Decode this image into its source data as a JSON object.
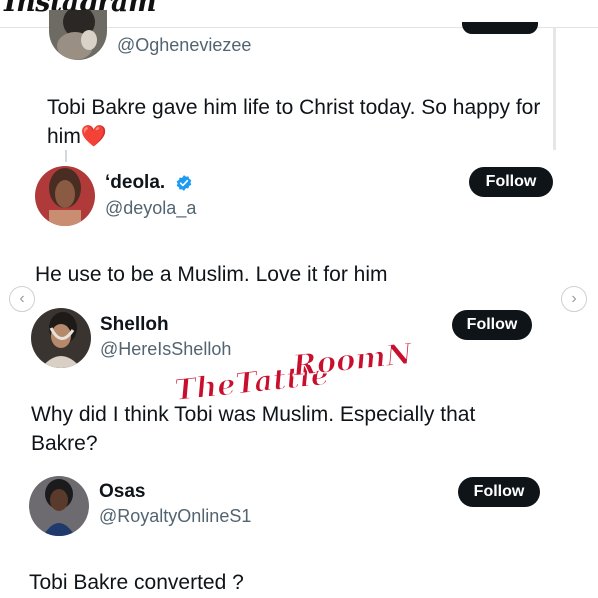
{
  "app": {
    "logo": "Instagram"
  },
  "tweets": [
    {
      "handle": "@Ogheneviezee",
      "text": "Tobi Bakre gave him life to Christ today. So happy for him",
      "emoji": "❤️"
    },
    {
      "name": "‘deola.",
      "verified": true,
      "handle": "@deyola_a",
      "follow_label": "Follow",
      "text": "He use to be a Muslim. Love it for him"
    },
    {
      "name": "Shelloh",
      "handle": "@HereIsShelloh",
      "follow_label": "Follow",
      "text": "Why did I think Tobi was Muslim. Especially that Bakre?"
    },
    {
      "name": "Osas",
      "handle": "@RoyaltyOnlineS1",
      "follow_label": "Follow",
      "text": "Tobi Bakre converted ?"
    }
  ],
  "watermark": {
    "line1": "TheTattle",
    "line2": "RoomNg"
  },
  "carousel": {
    "prev_icon": "chevron-left-icon",
    "next_icon": "chevron-right-icon"
  },
  "colors": {
    "text": "#0f1419",
    "secondary": "#536471",
    "button": "#0f1419",
    "verified": "#1d9bf0",
    "watermark": "#c8102e",
    "heart": "#e0245e"
  }
}
